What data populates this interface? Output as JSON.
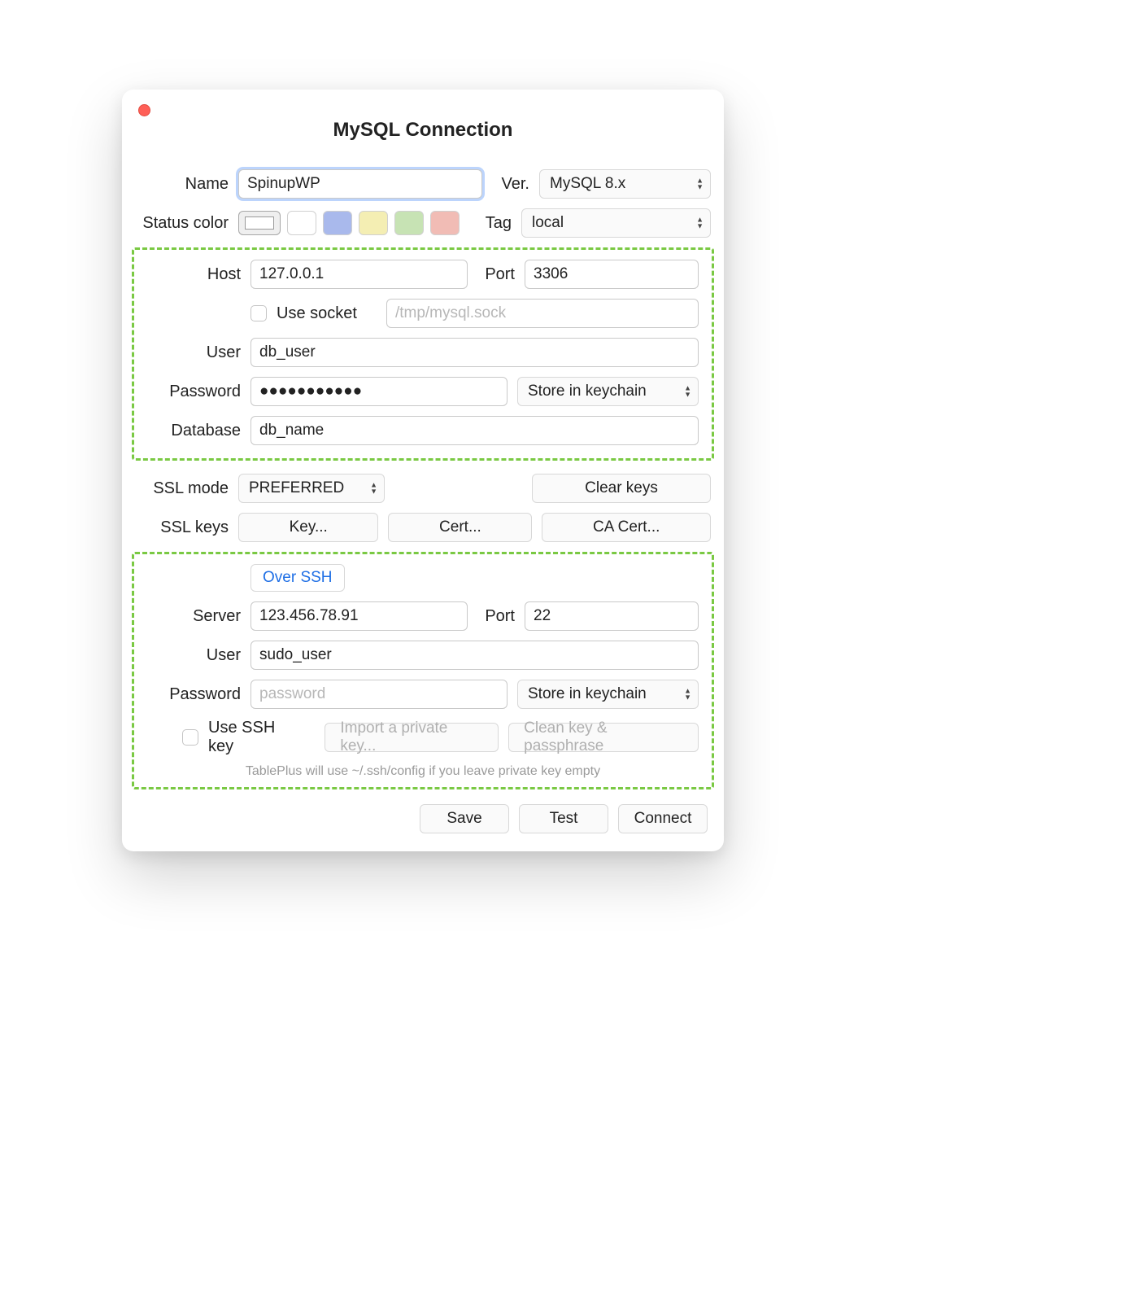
{
  "title": "MySQL Connection",
  "name": {
    "label": "Name",
    "value": "SpinupWP"
  },
  "version": {
    "label": "Ver.",
    "value": "MySQL 8.x"
  },
  "status_color": {
    "label": "Status color"
  },
  "tag": {
    "label": "Tag",
    "value": "local"
  },
  "colors": {
    "swatch_white": "#ffffff",
    "swatch_blue": "#a9b9ec",
    "swatch_yellow": "#f4eeb3",
    "swatch_green": "#c7e3b4",
    "swatch_red": "#f1bcb5"
  },
  "db": {
    "host_label": "Host",
    "host_value": "127.0.0.1",
    "port_label": "Port",
    "port_value": "3306",
    "use_socket_label": "Use socket",
    "socket_placeholder": "/tmp/mysql.sock",
    "user_label": "User",
    "user_value": "db_user",
    "password_label": "Password",
    "password_value": "●●●●●●●●●●●",
    "keychain_label": "Store in keychain",
    "database_label": "Database",
    "database_value": "db_name"
  },
  "ssl": {
    "mode_label": "SSL mode",
    "mode_value": "PREFERRED",
    "clear_keys": "Clear keys",
    "keys_label": "SSL keys",
    "key_btn": "Key...",
    "cert_btn": "Cert...",
    "ca_btn": "CA Cert..."
  },
  "ssh": {
    "over_ssh": "Over SSH",
    "server_label": "Server",
    "server_value": "123.456.78.91",
    "port_label": "Port",
    "port_value": "22",
    "user_label": "User",
    "user_value": "sudo_user",
    "password_label": "Password",
    "password_placeholder": "password",
    "keychain_label": "Store in keychain",
    "use_key_label": "Use SSH key",
    "import_btn": "Import a private key...",
    "clean_btn": "Clean key & passphrase",
    "hint": "TablePlus will use ~/.ssh/config if you leave private key empty"
  },
  "footer": {
    "save": "Save",
    "test": "Test",
    "connect": "Connect"
  }
}
